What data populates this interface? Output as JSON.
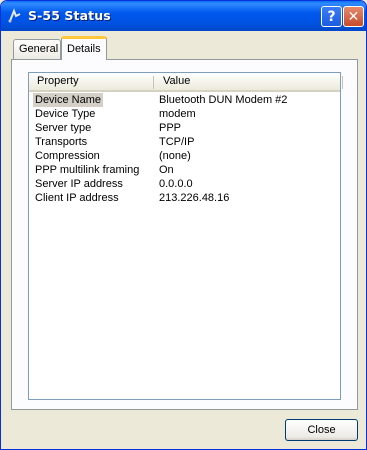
{
  "window": {
    "title": "S-55 Status",
    "help_label": "?",
    "close_label": "✕"
  },
  "tabs": [
    {
      "label": "General",
      "active": false
    },
    {
      "label": "Details",
      "active": true
    }
  ],
  "listview": {
    "columns": [
      "Property",
      "Value"
    ],
    "rows": [
      {
        "property": "Device Name",
        "value": "Bluetooth DUN Modem #2",
        "selected": true
      },
      {
        "property": "Device Type",
        "value": "modem"
      },
      {
        "property": "Server type",
        "value": "PPP"
      },
      {
        "property": "Transports",
        "value": "TCP/IP"
      },
      {
        "property": "Compression",
        "value": "(none)"
      },
      {
        "property": "PPP multilink framing",
        "value": "On"
      },
      {
        "property": "Server IP address",
        "value": "0.0.0.0"
      },
      {
        "property": "Client IP address",
        "value": "213.226.48.16"
      }
    ]
  },
  "buttons": {
    "close": "Close"
  },
  "colors": {
    "titlebar": "#0053e4",
    "selection": "#d4d0c8",
    "tab_highlight": "#ffc73c"
  }
}
